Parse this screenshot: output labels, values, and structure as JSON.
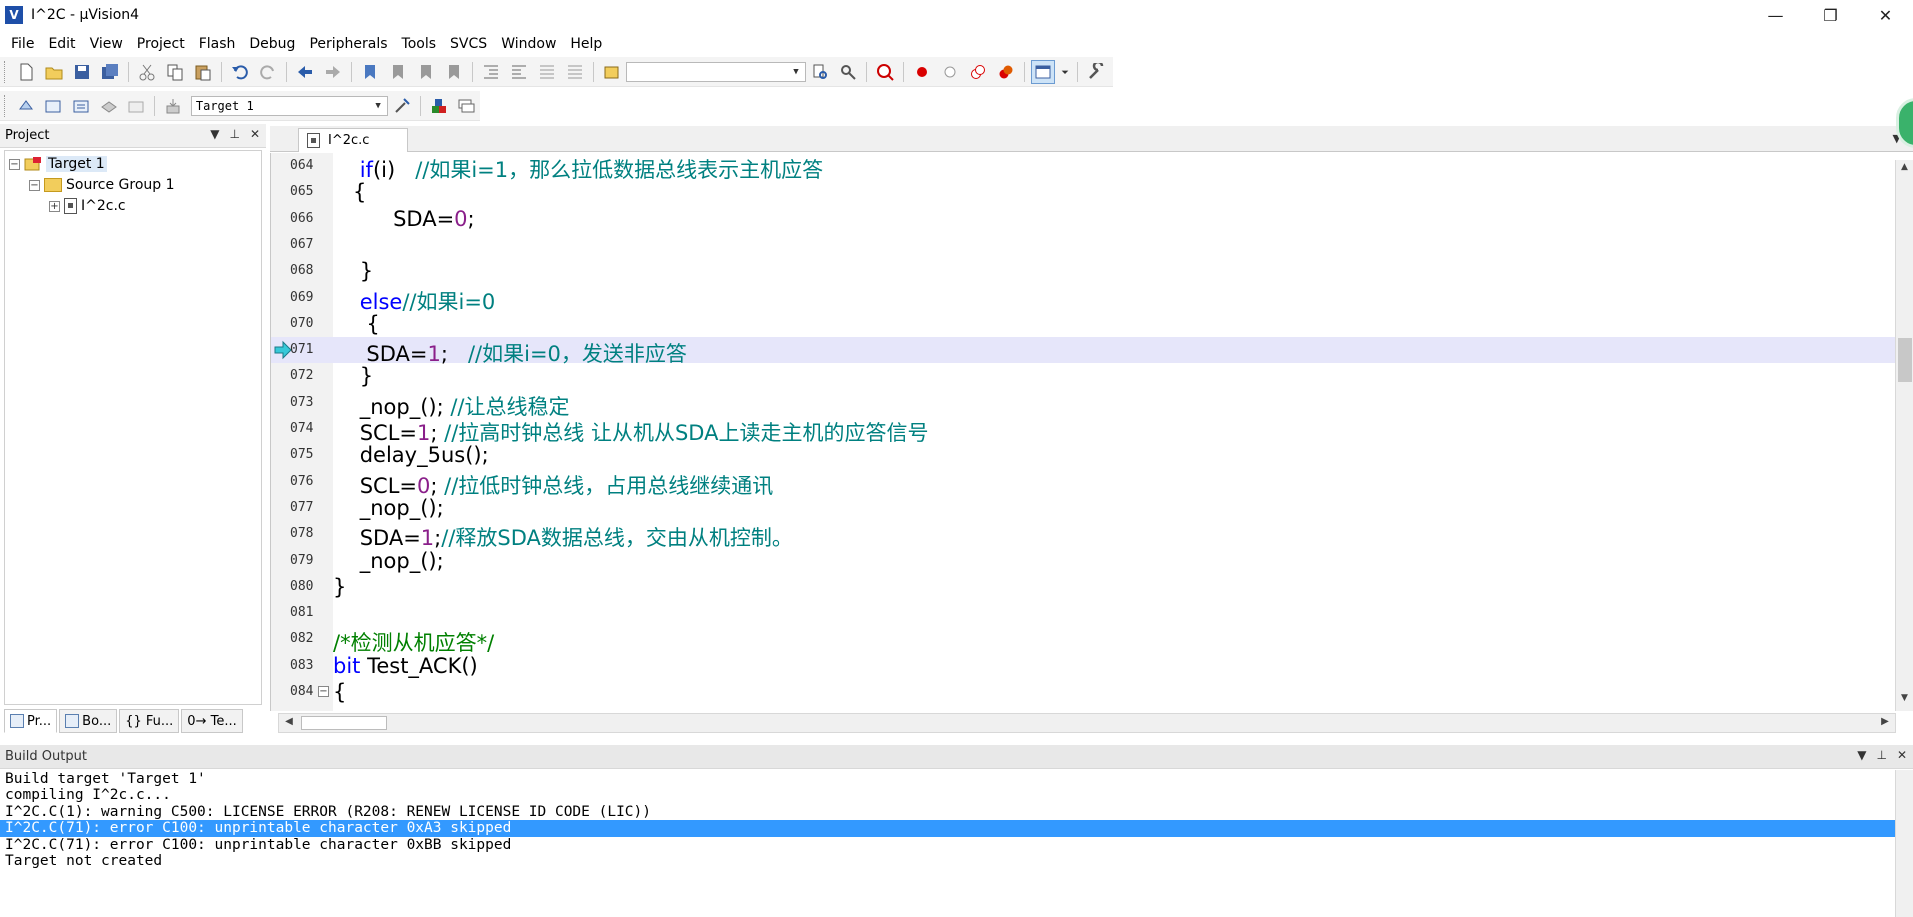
{
  "window": {
    "title": "I^2C - µVision4",
    "logo": "V",
    "controls": {
      "minimize": "—",
      "maximize": "❐",
      "close": "✕"
    }
  },
  "menu": [
    "File",
    "Edit",
    "View",
    "Project",
    "Flash",
    "Debug",
    "Peripherals",
    "Tools",
    "SVCS",
    "Window",
    "Help"
  ],
  "toolbar": {
    "search_combo_value": "",
    "target_combo_value": "Target 1"
  },
  "project_panel": {
    "title": "Project",
    "tree": {
      "target": "Target 1",
      "group": "Source Group 1",
      "file": "I^2c.c"
    },
    "tabs": [
      "Pr...",
      "Bo...",
      "{} Fu...",
      "0→ Te..."
    ]
  },
  "editor": {
    "tab_label": "I^2c.c",
    "current_line": "071",
    "lines": [
      {
        "no": "064",
        "parts": [
          {
            "t": "    ",
            "c": ""
          },
          {
            "t": "if",
            "c": "kw"
          },
          {
            "t": "(i)   ",
            "c": ""
          },
          {
            "t": "//如果i=1，那么拉低数据总线表示主机应答",
            "c": "cmt"
          }
        ]
      },
      {
        "no": "065",
        "parts": [
          {
            "t": "   {",
            "c": ""
          }
        ]
      },
      {
        "no": "066",
        "parts": [
          {
            "t": "         SDA=",
            "c": ""
          },
          {
            "t": "0",
            "c": "num"
          },
          {
            "t": ";",
            "c": ""
          }
        ]
      },
      {
        "no": "067",
        "parts": []
      },
      {
        "no": "068",
        "parts": [
          {
            "t": "    }",
            "c": ""
          }
        ]
      },
      {
        "no": "069",
        "parts": [
          {
            "t": "    ",
            "c": ""
          },
          {
            "t": "else",
            "c": "kw"
          },
          {
            "t": "//如果i=0",
            "c": "cmt"
          }
        ]
      },
      {
        "no": "070",
        "parts": [
          {
            "t": "     {",
            "c": ""
          }
        ]
      },
      {
        "no": "071",
        "parts": [
          {
            "t": "     SDA=",
            "c": ""
          },
          {
            "t": "1",
            "c": "num"
          },
          {
            "t": ";   ",
            "c": ""
          },
          {
            "t": "//如果i=0，发送非应答",
            "c": "cmt"
          }
        ]
      },
      {
        "no": "072",
        "parts": [
          {
            "t": "    }",
            "c": ""
          }
        ]
      },
      {
        "no": "073",
        "parts": [
          {
            "t": "    _nop_(); ",
            "c": ""
          },
          {
            "t": "//让总线稳定",
            "c": "cmt"
          }
        ]
      },
      {
        "no": "074",
        "parts": [
          {
            "t": "    SCL=",
            "c": ""
          },
          {
            "t": "1",
            "c": "num"
          },
          {
            "t": "; ",
            "c": ""
          },
          {
            "t": "//拉高时钟总线 让从机从SDA上读走主机的应答信号",
            "c": "cmt"
          }
        ]
      },
      {
        "no": "075",
        "parts": [
          {
            "t": "    delay_5us();",
            "c": ""
          }
        ]
      },
      {
        "no": "076",
        "parts": [
          {
            "t": "    SCL=",
            "c": ""
          },
          {
            "t": "0",
            "c": "num"
          },
          {
            "t": "; ",
            "c": ""
          },
          {
            "t": "//拉低时钟总线，占用总线继续通讯",
            "c": "cmt"
          }
        ]
      },
      {
        "no": "077",
        "parts": [
          {
            "t": "    _nop_();",
            "c": ""
          }
        ]
      },
      {
        "no": "078",
        "parts": [
          {
            "t": "    SDA=",
            "c": ""
          },
          {
            "t": "1",
            "c": "num"
          },
          {
            "t": ";",
            "c": ""
          },
          {
            "t": "//释放SDA数据总线，交由从机控制。",
            "c": "cmt"
          }
        ]
      },
      {
        "no": "079",
        "parts": [
          {
            "t": "    _nop_();",
            "c": ""
          }
        ]
      },
      {
        "no": "080",
        "parts": [
          {
            "t": "}",
            "c": ""
          }
        ]
      },
      {
        "no": "081",
        "parts": []
      },
      {
        "no": "082",
        "parts": [
          {
            "t": "/*检测从机应答*/",
            "c": "cmt-green"
          }
        ]
      },
      {
        "no": "083",
        "parts": [
          {
            "t": "bit",
            "c": "kw"
          },
          {
            "t": " Test_ACK()",
            "c": ""
          }
        ]
      },
      {
        "no": "084",
        "parts": [
          {
            "t": "{",
            "c": ""
          }
        ],
        "fold": "⊟"
      }
    ]
  },
  "build_output": {
    "title": "Build Output",
    "selected_index": 3,
    "lines": [
      "Build target 'Target 1'",
      "compiling I^2c.c...",
      "I^2C.C(1): warning C500: LICENSE ERROR (R208: RENEW LICENSE ID CODE (LIC))",
      "I^2C.C(71): error C100: unprintable character 0xA3 skipped",
      "I^2C.C(71): error C100: unprintable character 0xBB skipped",
      "Target not created"
    ]
  },
  "colors": {
    "keyword": "#0000ff",
    "number": "#8a1f8a",
    "comment": "#008080",
    "block_comment": "#008000",
    "current_line_bg": "#e6e6fa",
    "selection": "#3399ff"
  }
}
